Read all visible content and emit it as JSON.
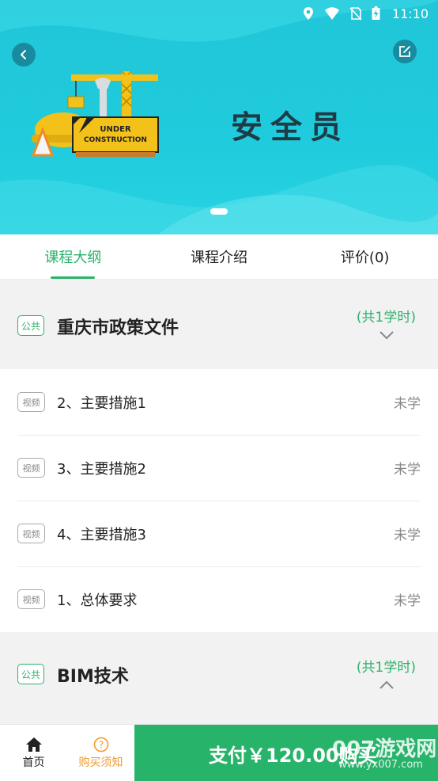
{
  "status_bar": {
    "time": "11:10"
  },
  "banner": {
    "title": "安全员",
    "illustration_text_1": "UNDER",
    "illustration_text_2": "CONSTRUCTION"
  },
  "tabs": [
    {
      "label": "课程大纲",
      "active": true
    },
    {
      "label": "课程介绍",
      "active": false
    },
    {
      "label": "评价(0)",
      "active": false
    }
  ],
  "sections": [
    {
      "tag": "公共",
      "title": "重庆市政策文件",
      "hours": "(共1学时)",
      "expanded": true,
      "lessons": [
        {
          "tag": "视频",
          "name": "2、主要措施1",
          "status": "未学"
        },
        {
          "tag": "视频",
          "name": "3、主要措施2",
          "status": "未学"
        },
        {
          "tag": "视频",
          "name": "4、主要措施3",
          "status": "未学"
        },
        {
          "tag": "视频",
          "name": "1、总体要求",
          "status": "未学"
        }
      ]
    },
    {
      "tag": "公共",
      "title": "BIM技术",
      "hours": "(共1学时)",
      "expanded": false,
      "lessons": []
    }
  ],
  "bottom_bar": {
    "home_label": "首页",
    "notice_label": "购买须知",
    "pay_label": "支付￥120.00购买",
    "watermark": "007游戏网",
    "watermark_url": "www.yx007.com"
  },
  "colors": {
    "accent": "#2bb26a",
    "banner": "#21c6d8",
    "notice": "#f39a2a"
  }
}
